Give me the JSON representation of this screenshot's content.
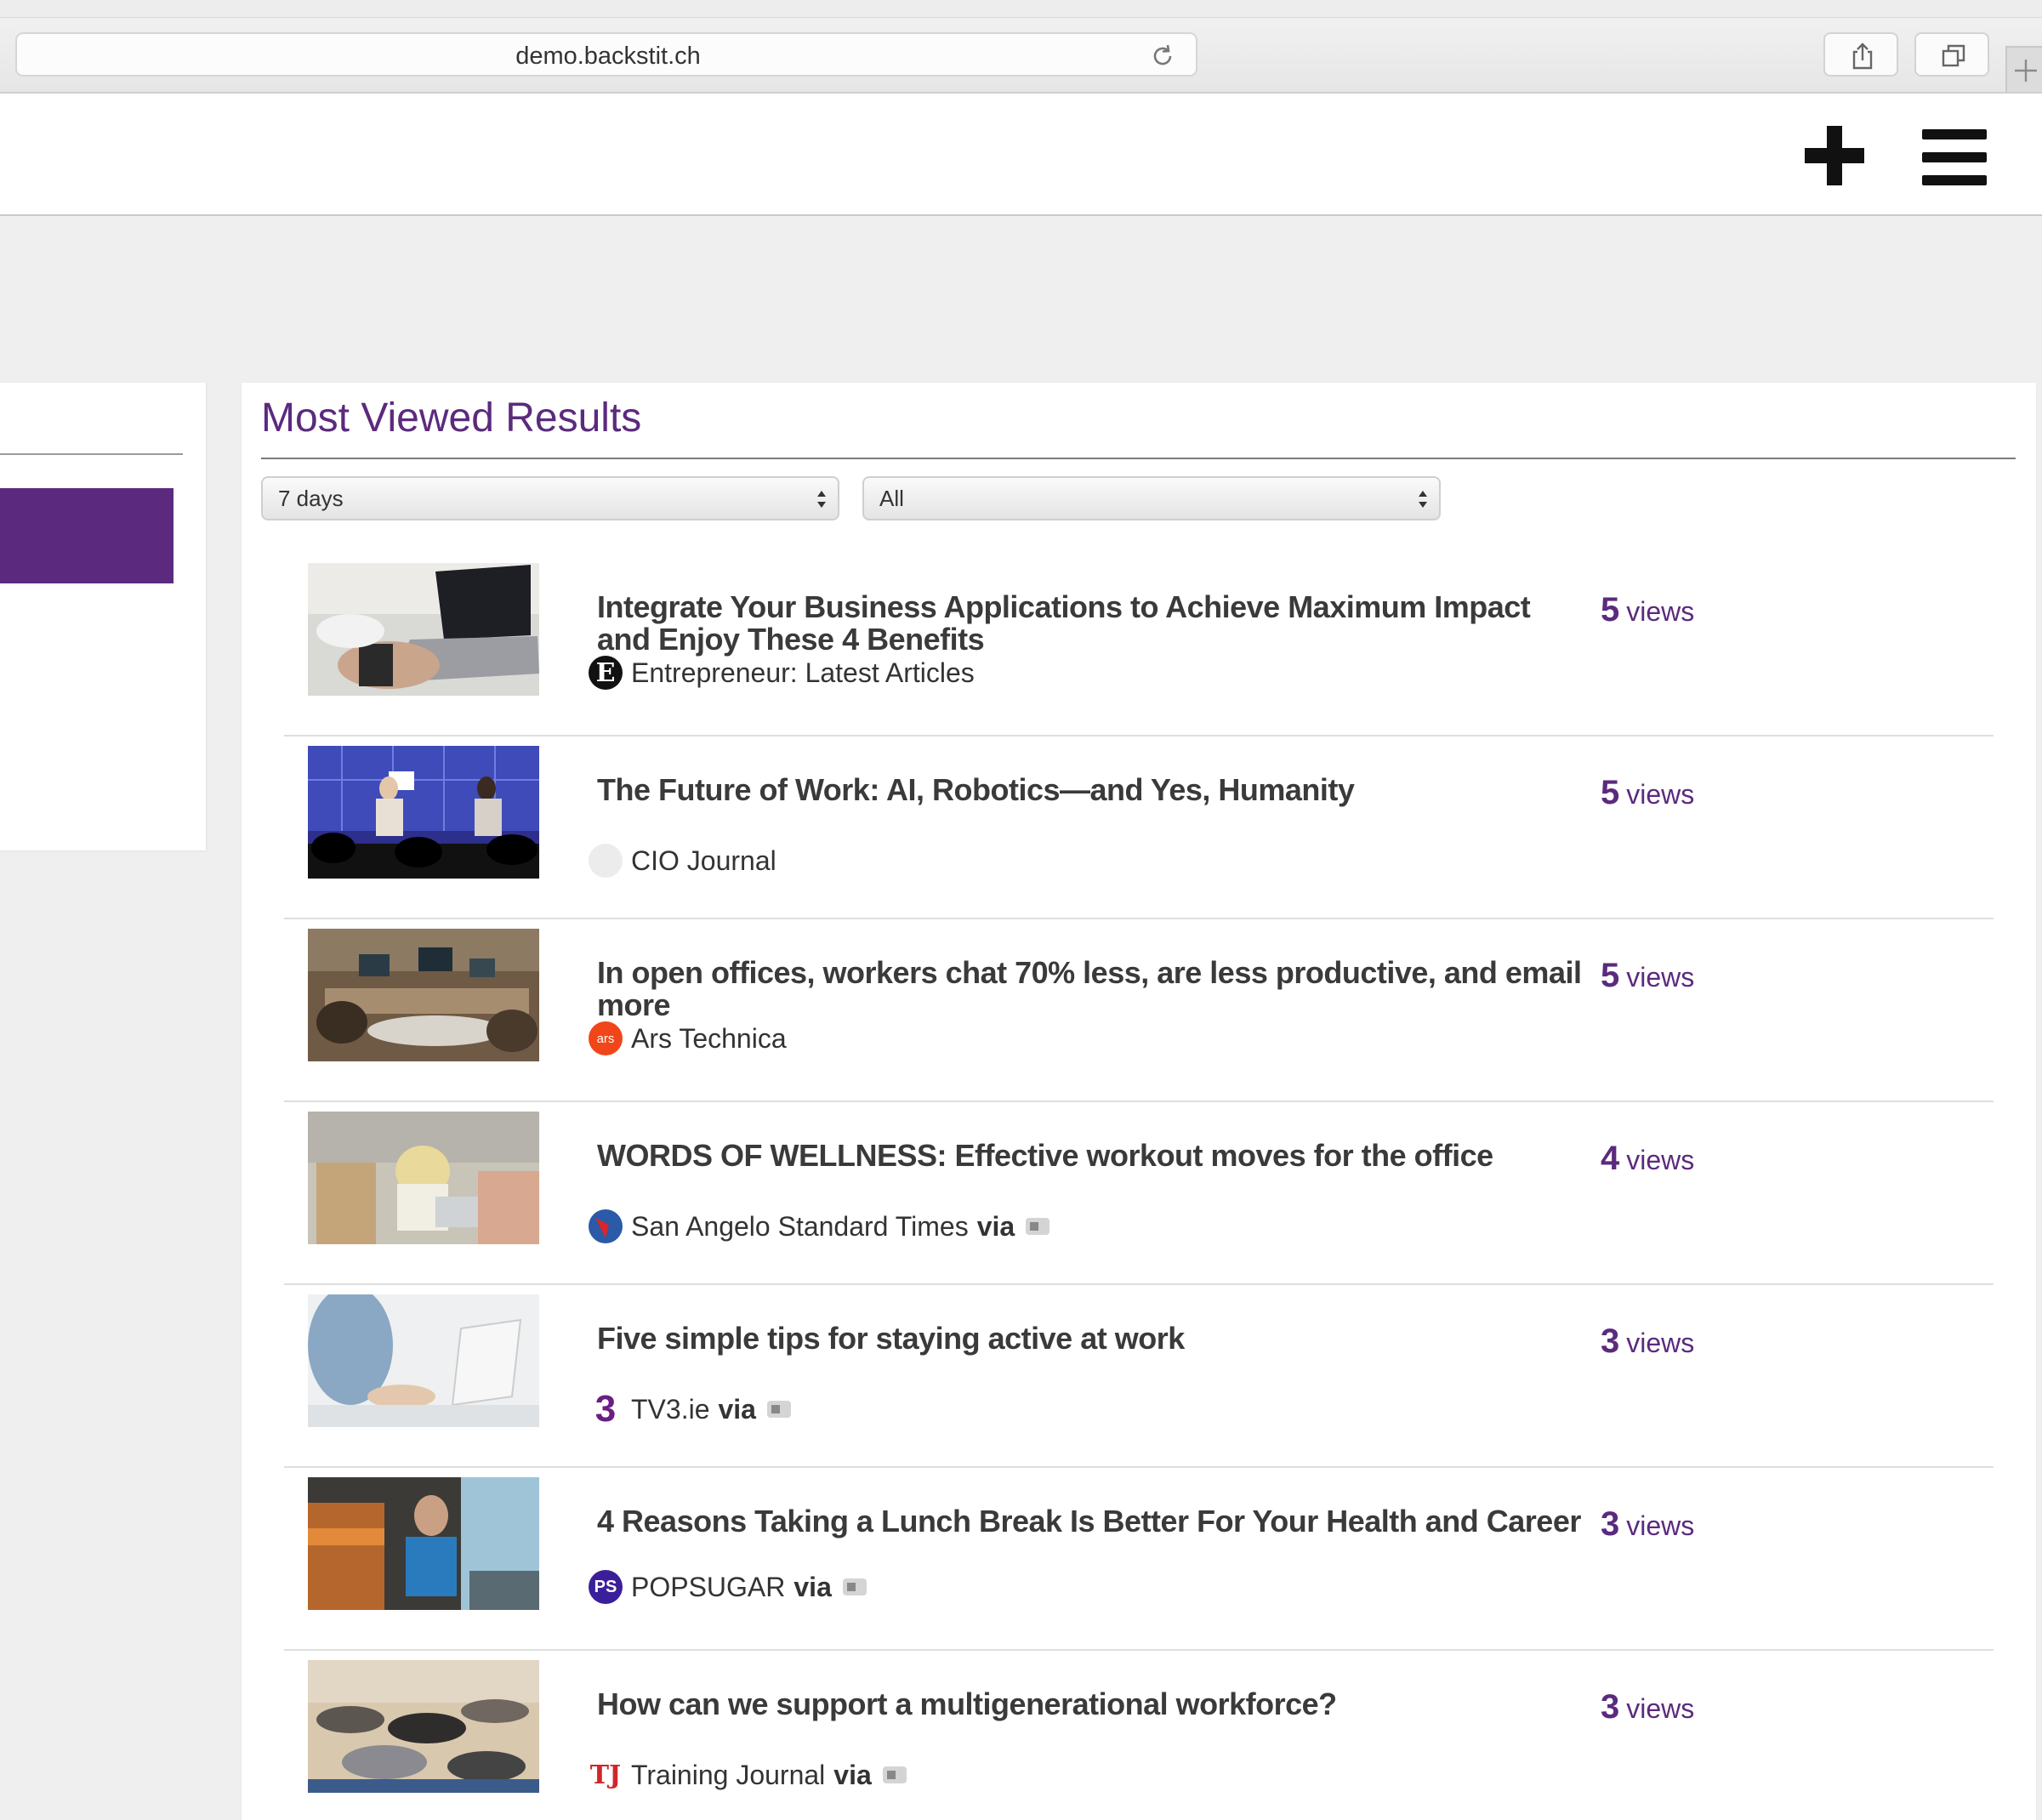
{
  "browser": {
    "url": "demo.backstit.ch"
  },
  "header": {
    "add_icon": "plus-icon",
    "menu_icon": "hamburger-menu-icon"
  },
  "main": {
    "title": "Most Viewed Results",
    "filters": {
      "period": "7 days",
      "scope": "All"
    },
    "results": [
      {
        "title": "Integrate Your Business Applications to Achieve Maximum Impact and Enjoy These 4 Benefits",
        "source": "Entrepreneur: Latest Articles",
        "via": "",
        "views": "5",
        "views_label": "views"
      },
      {
        "title": "The Future of Work: AI, Robotics—and Yes, Humanity",
        "source": "CIO Journal",
        "via": "",
        "views": "5",
        "views_label": "views"
      },
      {
        "title": "In open offices, workers chat 70% less, are less productive, and email more",
        "source": "Ars Technica",
        "via": "",
        "views": "5",
        "views_label": "views"
      },
      {
        "title": "WORDS OF WELLNESS: Effective workout moves for the office",
        "source": "San Angelo Standard Times",
        "via": "via",
        "views": "4",
        "views_label": "views"
      },
      {
        "title": "Five simple tips for staying active at work",
        "source": "TV3.ie",
        "via": "via",
        "views": "3",
        "views_label": "views"
      },
      {
        "title": "4 Reasons Taking a Lunch Break Is Better For Your Health and Career",
        "source": "POPSUGAR",
        "via": "via",
        "views": "3",
        "views_label": "views"
      },
      {
        "title": "How can we support a multigenerational workforce?",
        "source": "Training Journal",
        "via": "via",
        "views": "3",
        "views_label": "views"
      }
    ]
  },
  "icons": {
    "entrepreneur": "E",
    "ars": "ars",
    "tv3": "3",
    "popsugar": "PS",
    "training_journal": "TJ"
  },
  "colors": {
    "accent": "#5b2a7e"
  }
}
